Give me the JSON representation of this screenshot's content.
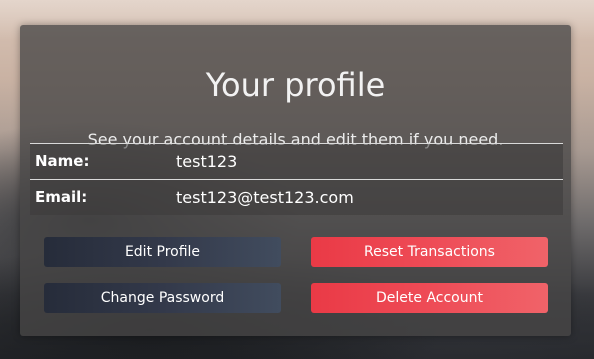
{
  "profile": {
    "title": "Your profile",
    "subtitle": "See your account details and edit them if you need.",
    "fields": [
      {
        "label": "Name:",
        "value": "test123"
      },
      {
        "label": "Email:",
        "value": "test123@test123.com"
      }
    ]
  },
  "actions": {
    "edit_profile": "Edit Profile",
    "reset_transactions": "Reset Transactions",
    "change_password": "Change Password",
    "delete_account": "Delete Account"
  },
  "colors": {
    "dark_button": "#2f3545",
    "danger_button": "#ee4b56",
    "card_background": "#484646"
  }
}
